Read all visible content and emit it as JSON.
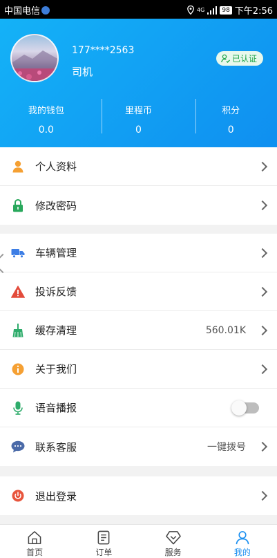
{
  "status_bar": {
    "carrier": "中国电信",
    "signal": "4G",
    "battery": "98",
    "time": "下午2:56"
  },
  "profile": {
    "phone": "177****2563",
    "role": "司机",
    "verified_label": "已认证"
  },
  "stats": [
    {
      "label": "我的钱包",
      "value": "0.0"
    },
    {
      "label": "里程币",
      "value": "0"
    },
    {
      "label": "积分",
      "value": "0"
    }
  ],
  "menu_groups": [
    [
      {
        "label": "个人资料",
        "icon": "person-icon",
        "icon_color": "#f5a033"
      },
      {
        "label": "修改密码",
        "icon": "lock-icon",
        "icon_color": "#29a85c"
      }
    ],
    [
      {
        "label": "车辆管理",
        "icon": "truck-icon",
        "icon_color": "#3d7ee5"
      },
      {
        "label": "投诉反馈",
        "icon": "warning-icon",
        "icon_color": "#e34b3b"
      },
      {
        "label": "缓存清理",
        "icon": "broom-icon",
        "icon_color": "#2eac6b",
        "value": "560.01K"
      },
      {
        "label": "关于我们",
        "icon": "info-icon",
        "icon_color": "#f5a033"
      },
      {
        "label": "语音播报",
        "icon": "microphone-icon",
        "icon_color": "#2eac6b",
        "toggle_on": false
      },
      {
        "label": "联系客服",
        "icon": "chat-icon",
        "icon_color": "#4a6aa8",
        "value": "一键拨号"
      }
    ],
    [
      {
        "label": "退出登录",
        "icon": "power-icon",
        "icon_color": "#e8553d"
      }
    ]
  ],
  "tabs": [
    {
      "label": "首页",
      "icon": "home-icon"
    },
    {
      "label": "订单",
      "icon": "list-icon"
    },
    {
      "label": "服务",
      "icon": "service-icon"
    },
    {
      "label": "我的",
      "icon": "user-icon",
      "active": true
    }
  ],
  "colors": {
    "accent": "#1a8ff0",
    "header_start": "#14b2f7",
    "header_end": "#0f8ff0",
    "verified_green": "#1fa54a"
  }
}
